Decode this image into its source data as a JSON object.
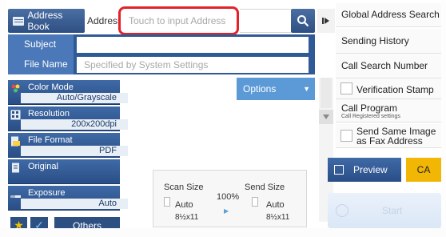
{
  "top_bar": {
    "address_book_label": "Address Book",
    "address_field_label": "Address",
    "address_placeholder": "Touch to input Address",
    "search_icon": "search-icon",
    "collapse_icon": "play-pause-icon"
  },
  "form": {
    "subject_label": "Subject",
    "subject_value": "",
    "file_name_label": "File Name",
    "file_name_placeholder": "Specified by System Settings"
  },
  "options": {
    "label": "Options"
  },
  "settings": [
    {
      "name": "color-mode",
      "label": "Color Mode",
      "value": "Auto/Grayscale",
      "icon": "color-mode-icon"
    },
    {
      "name": "resolution",
      "label": "Resolution",
      "value": "200x200dpi",
      "icon": "resolution-icon"
    },
    {
      "name": "file-format",
      "label": "File Format",
      "value": "PDF",
      "icon": "file-format-icon"
    },
    {
      "name": "original",
      "label": "Original",
      "value": "",
      "icon": "original-icon"
    },
    {
      "name": "exposure",
      "label": "Exposure",
      "value": "Auto",
      "icon": "exposure-icon"
    }
  ],
  "bottom_tabs": {
    "favorite_icon": "star-icon",
    "check_icon": "checkmark-icon",
    "others_label": "Others"
  },
  "scan_panel": {
    "scan_size_label": "Scan Size",
    "scan_size_value": "Auto",
    "scan_paper": "8½x11",
    "ratio": "100%",
    "send_size_label": "Send Size",
    "send_size_value": "Auto",
    "send_paper": "8½x11"
  },
  "right_panel": {
    "global_address_search": "Global Address Search",
    "sending_history": "Sending History",
    "call_search_number": "Call Search Number",
    "verification_stamp": "Verification Stamp",
    "call_program": "Call Program",
    "call_program_sub": "Call Registered settings",
    "send_same_image_line1": "Send Same Image",
    "send_same_image_line2": "as Fax Address",
    "preview": "Preview",
    "ca": "CA",
    "start": "Start"
  },
  "colors": {
    "primary_blue": "#2e4f82",
    "highlight_red": "#e3222a",
    "ca_yellow": "#f2b705",
    "options_blue": "#5b9ad6"
  }
}
